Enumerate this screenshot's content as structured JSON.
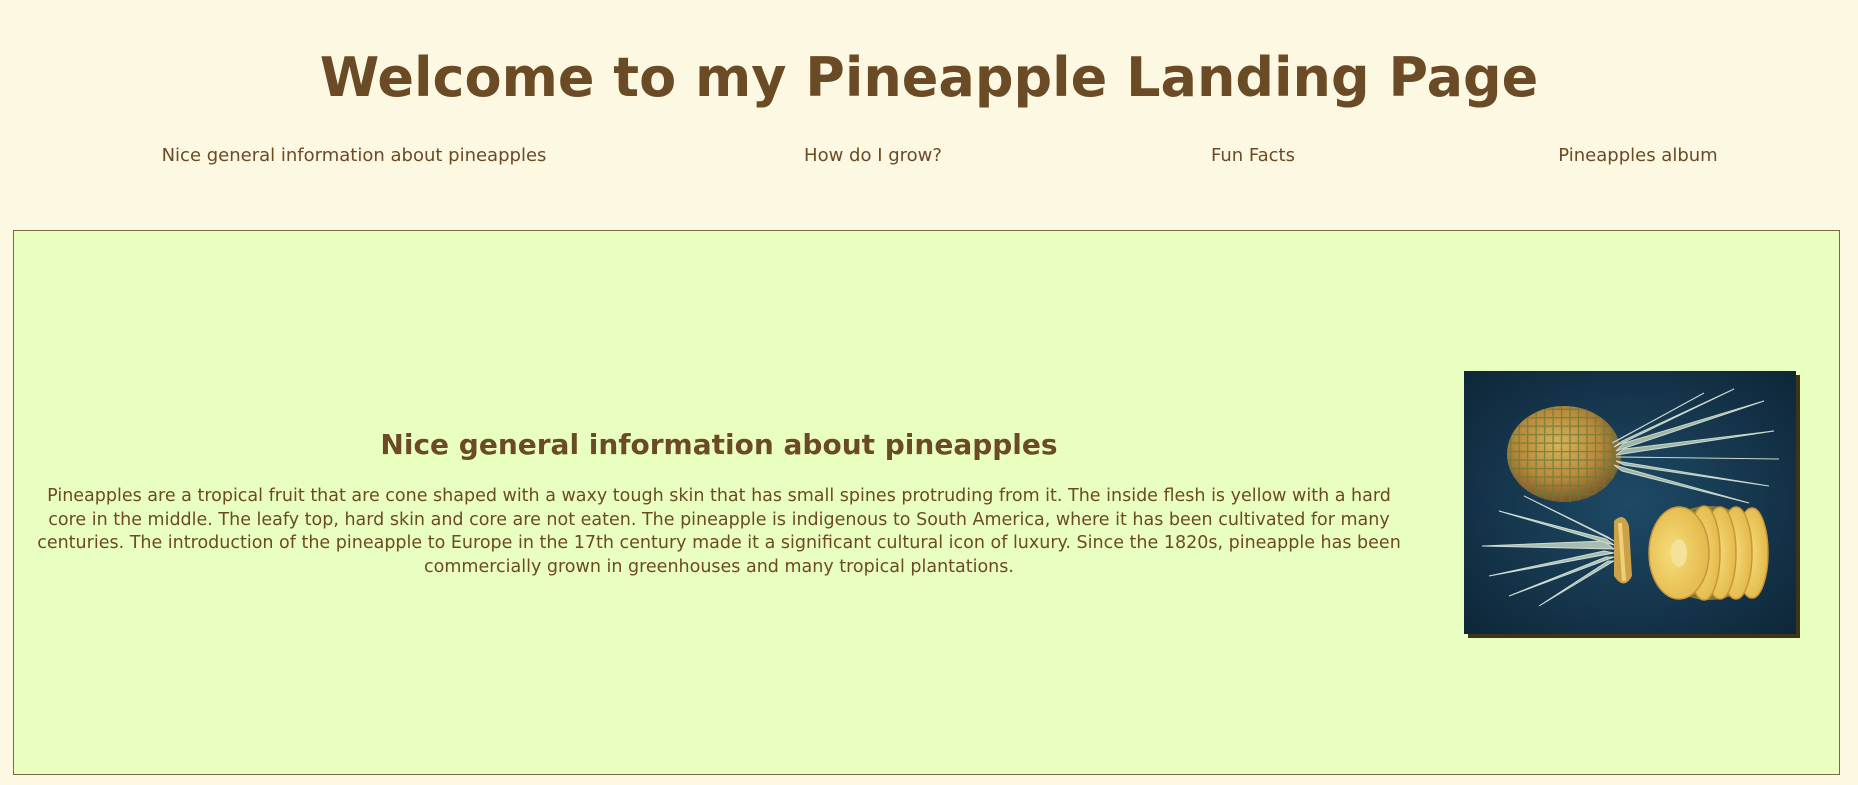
{
  "header": {
    "title": "Welcome to my Pineapple Landing Page"
  },
  "nav": {
    "items": [
      {
        "label": "Nice general information about pineapples"
      },
      {
        "label": "How do I grow?"
      },
      {
        "label": "Fun Facts"
      },
      {
        "label": "Pineapples album"
      }
    ]
  },
  "info_section": {
    "heading": "Nice general information about pineapples",
    "body": "Pineapples are a tropical fruit that are cone shaped with a waxy tough skin that has small spines protruding from it. The inside flesh is yellow with a hard core in the middle. The leafy top, hard skin and core are not eaten. The pineapple is indigenous to South America, where it has been cultivated for many centuries. The introduction of the pineapple to Europe in the 17th century made it a significant cultural icon of luxury. Since the 1820s, pineapple has been commercially grown in greenhouses and many tropical plantations."
  },
  "colors": {
    "page_background": "#fdf8e1",
    "section_background": "#e8ffc0",
    "text_brown": "#6b4a26",
    "image_background": "#143349"
  }
}
